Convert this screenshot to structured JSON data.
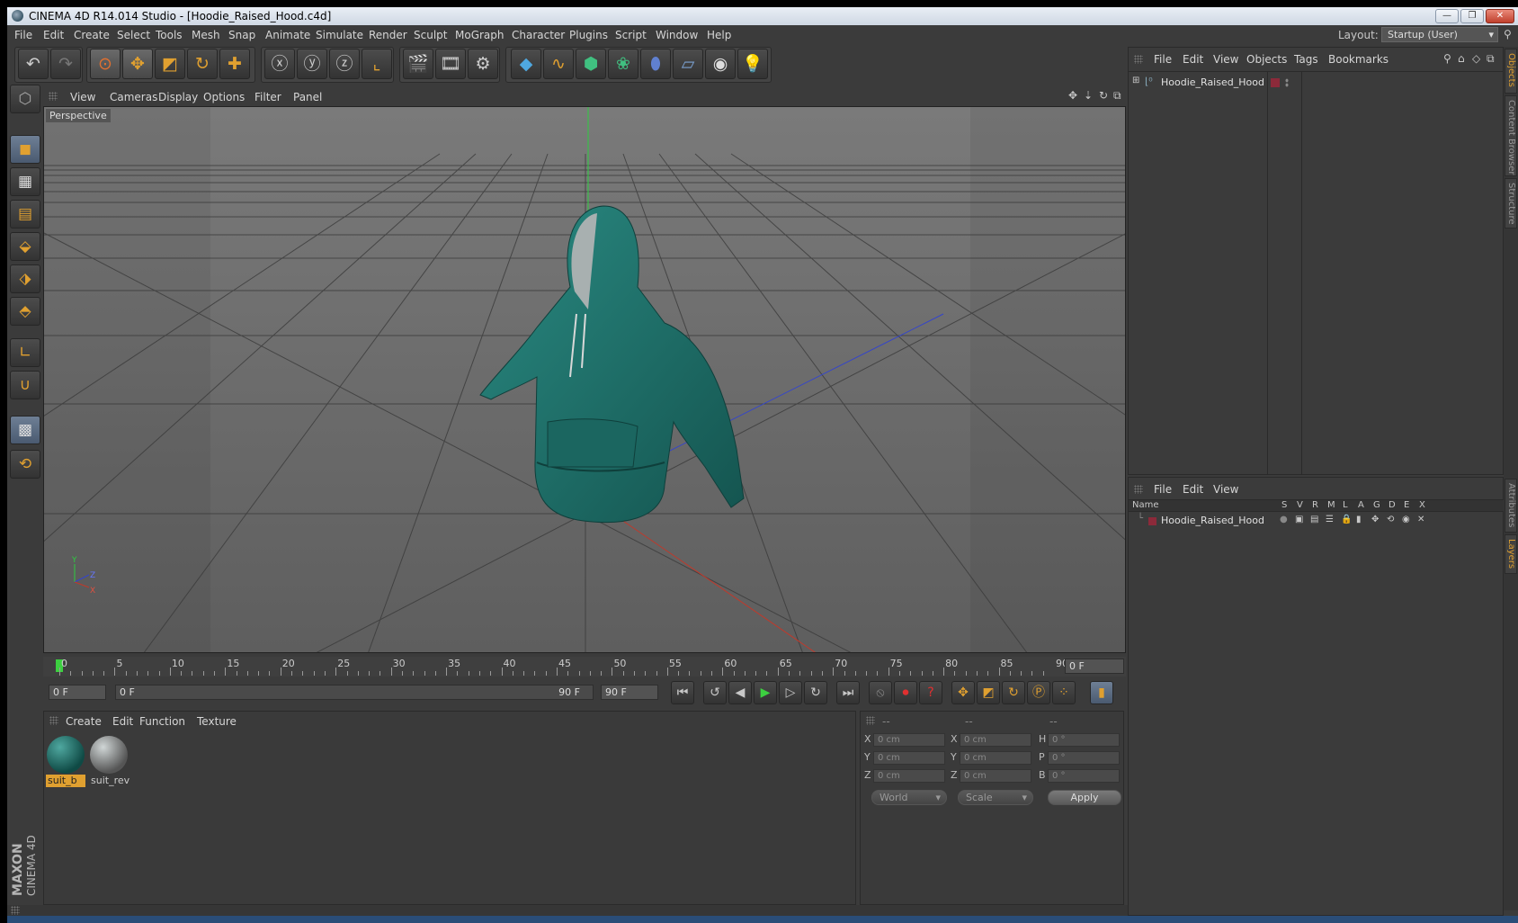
{
  "window": {
    "title": "CINEMA 4D R14.014 Studio - [Hoodie_Raised_Hood.c4d]",
    "minimize": "—",
    "restore": "❐",
    "close": "✕"
  },
  "menubar": [
    "File",
    "Edit",
    "Create",
    "Select",
    "Tools",
    "Mesh",
    "Snap",
    "Animate",
    "Simulate",
    "Render",
    "Sculpt",
    "MoGraph",
    "Character",
    "Plugins",
    "Script",
    "Window",
    "Help"
  ],
  "layout": {
    "label": "Layout:",
    "value": "Startup (User)"
  },
  "viewport": {
    "menu": [
      "View",
      "Cameras",
      "Display",
      "Options",
      "Filter",
      "Panel"
    ],
    "label": "Perspective",
    "axis_y": "Y",
    "axis_z": "Z",
    "axis_x": "X"
  },
  "timeline": {
    "ticks": [
      "0",
      "5",
      "10",
      "15",
      "20",
      "25",
      "30",
      "35",
      "40",
      "45",
      "50",
      "55",
      "60",
      "65",
      "70",
      "75",
      "80",
      "85",
      "90"
    ],
    "current_frame": "0 F",
    "start_field": "0 F",
    "range_start": "0 F",
    "range_end": "90 F",
    "end_field": "90 F"
  },
  "materials": {
    "menu": [
      "Create",
      "Edit",
      "Function",
      "Texture"
    ],
    "items": [
      {
        "name": "suit_b",
        "selected": true
      },
      {
        "name": "suit_rev",
        "selected": false
      }
    ]
  },
  "coordinates": {
    "headers": [
      "--",
      "--",
      "--"
    ],
    "rows": [
      {
        "l1": "X",
        "v1": "0 cm",
        "l2": "X",
        "v2": "0 cm",
        "l3": "H",
        "v3": "0 °"
      },
      {
        "l1": "Y",
        "v1": "0 cm",
        "l2": "Y",
        "v2": "0 cm",
        "l3": "P",
        "v3": "0 °"
      },
      {
        "l1": "Z",
        "v1": "0 cm",
        "l2": "Z",
        "v2": "0 cm",
        "l3": "B",
        "v3": "0 °"
      }
    ],
    "world": "World",
    "scale": "Scale",
    "apply": "Apply"
  },
  "objects_panel": {
    "menu": [
      "File",
      "Edit",
      "View",
      "Objects",
      "Tags",
      "Bookmarks"
    ],
    "object_name": "Hoodie_Raised_Hood"
  },
  "layers_panel": {
    "menu": [
      "File",
      "Edit",
      "View"
    ],
    "columns": [
      "Name",
      "S",
      "V",
      "R",
      "M",
      "L",
      "A",
      "G",
      "D",
      "E",
      "X"
    ],
    "layer_name": "Hoodie_Raised_Hood"
  },
  "side_tabs": [
    "Objects",
    "Content Browser",
    "Structure",
    "Attributes",
    "Layers"
  ],
  "branding": {
    "maxon": "MAXON",
    "product": "CINEMA 4D"
  },
  "colors": {
    "hoodie": "#1d6e68",
    "accent": "#e0a030",
    "layer_color": "#8c2a3a",
    "axis_x": "#c0392b",
    "axis_y": "#2ecc40",
    "axis_z": "#3344cc"
  }
}
